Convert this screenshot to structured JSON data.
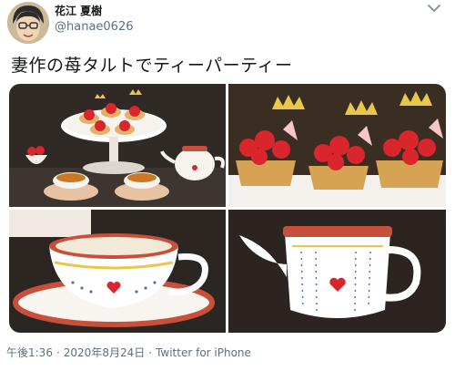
{
  "tweet": {
    "author": {
      "display_name": "花江 夏樹",
      "handle": "@hanae0626",
      "avatar_icon": "cartoon-face-avatar-icon"
    },
    "menu_icon": "chevron-down-icon",
    "text": "妻作の苺タルトでティーパーティー",
    "media": [
      {
        "subject": "tiered stand with strawberry tarts, teapot and teacups"
      },
      {
        "subject": "strawberry tarts with gold crowns"
      },
      {
        "subject": "teacup with heart pattern"
      },
      {
        "subject": "teapot with heart pattern"
      }
    ],
    "meta": {
      "time": "午後1:36",
      "separator": "·",
      "date": "2020年8月24日",
      "separator2": "·",
      "source": "Twitter for iPhone"
    }
  },
  "colors": {
    "secondary_text": "#5b7083",
    "primary_text": "#14171a",
    "strawberry_red": "#d8262c",
    "gold": "#e8c84a",
    "teacup_rim": "#c8503a"
  }
}
